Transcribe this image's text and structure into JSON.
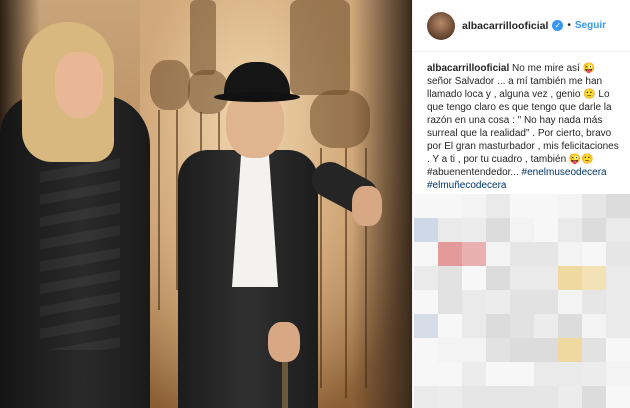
{
  "post": {
    "username": "albacarrillooficial",
    "verified_glyph": "✓",
    "separator": "•",
    "follow_label": "Seguir",
    "caption_username": "albacarrillooficial",
    "caption_text": "No me mire así 😜 señor Salvador ... a mí también me han llamado loca y , alguna vez , genio 🙂 Lo que tengo claro es que tengo que darle la razón en una cosa : \" No hay nada más surreal que la realidad\" . Por cierto, bravo por El gran masturbador , mis felicitaciones . Y a ti , por tu cuadro , también 😜🙂 #abuenentendedor...",
    "hashtags": "#enelmuseodecera #elmuñecodecera"
  },
  "colors": {
    "accent": "#3897f0",
    "hashtag": "#003569"
  }
}
